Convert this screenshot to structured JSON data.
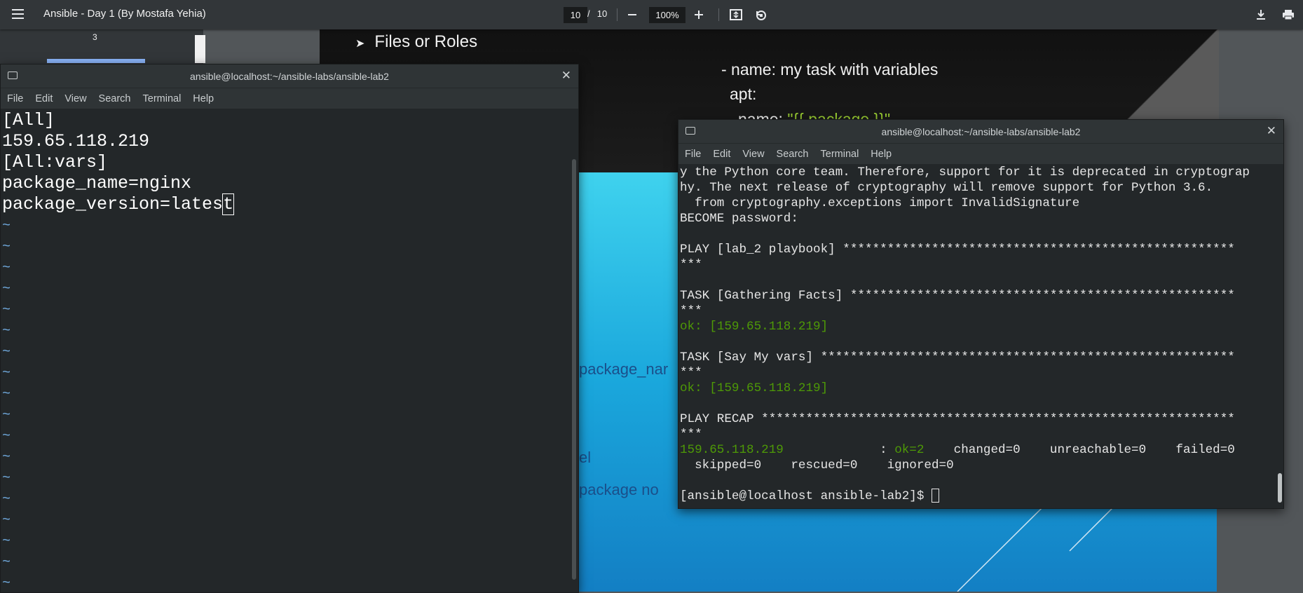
{
  "pdf_viewer": {
    "title": "Ansible - Day 1 (By Mostafa Yehia)",
    "current_page": "10",
    "page_separator": "/",
    "total_pages": "10",
    "zoom": "100%",
    "thumbnail_page_number": "3",
    "icons": {
      "menu": "hamburger-icon",
      "zoom_out": "minus-icon",
      "zoom_in": "plus-icon",
      "fit": "fit-to-page-icon",
      "rotate": "rotate-icon",
      "download": "download-icon",
      "print": "print-icon"
    }
  },
  "slide": {
    "bullet": "Files or Roles",
    "code_line1": "- name: my task with variables",
    "code_line2": "apt:",
    "code_line3": "name: \"{{ package }}\"",
    "blue_text1": "package_nar",
    "blue_text2": "el",
    "blue_text3": "package no"
  },
  "terminal_left": {
    "title": "ansible@localhost:~/ansible-labs/ansible-lab2",
    "menu": [
      "File",
      "Edit",
      "View",
      "Search",
      "Terminal",
      "Help"
    ],
    "lines": [
      "[All]",
      "159.65.118.219",
      "[All:vars]",
      "package_name=nginx",
      "package_version=lates"
    ],
    "cursor_char": "t",
    "tilde": "~"
  },
  "terminal_right": {
    "title": "ansible@localhost:~/ansible-labs/ansible-lab2",
    "menu": [
      "File",
      "Edit",
      "View",
      "Search",
      "Terminal",
      "Help"
    ],
    "lines": {
      "l1": "y the Python core team. Therefore, support for it is deprecated in cryptograp",
      "l2": "hy. The next release of cryptography will remove support for Python 3.6.",
      "l3": "  from cryptography.exceptions import InvalidSignature",
      "l4": "BECOME password:",
      "l5": "PLAY [lab_2 playbook] *****************************************************",
      "l6": "***",
      "l7": "TASK [Gathering Facts] ****************************************************",
      "l8": "***",
      "l9": "ok: [159.65.118.219]",
      "l10": "TASK [Say My vars] ********************************************************",
      "l11": "***",
      "l12": "ok: [159.65.118.219]",
      "l13": "PLAY RECAP ****************************************************************",
      "l14": "***",
      "recap_host": "159.65.118.219",
      "recap_colon": "             : ",
      "recap_ok": "ok=2",
      "recap_rest": "    changed=0    unreachable=0    failed=0",
      "l16": "  skipped=0    rescued=0    ignored=0",
      "prompt": "[ansible@localhost ansible-lab2]$ "
    }
  }
}
